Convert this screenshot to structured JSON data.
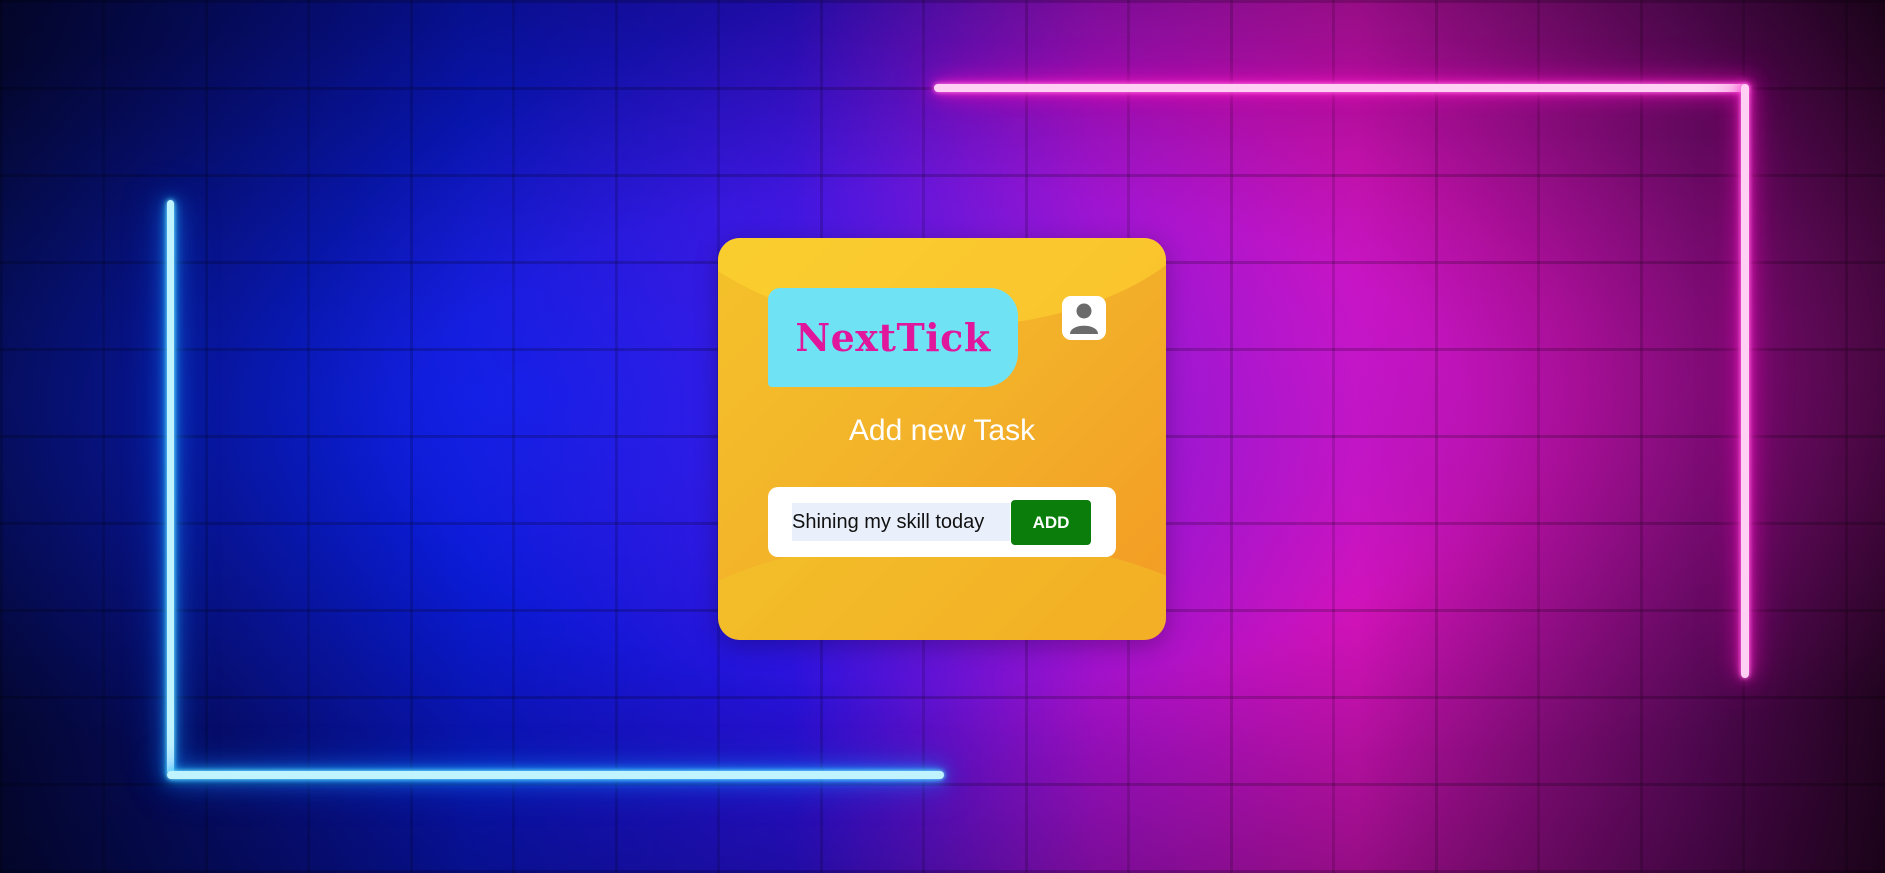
{
  "app": {
    "logo_text": "NextTick"
  },
  "header": {
    "avatar_icon": "user-icon"
  },
  "main": {
    "heading": "Add new Task",
    "task_input": {
      "value": "Shining my skill today",
      "placeholder": ""
    },
    "add_button_label": "ADD"
  },
  "colors": {
    "card": "#f3b32a",
    "logo_bg": "#6fe3f4",
    "logo_text": "#e0169c",
    "add_button": "#0a7d0a",
    "neon_blue": "#22c4ff",
    "neon_pink": "#ff2ed0"
  }
}
